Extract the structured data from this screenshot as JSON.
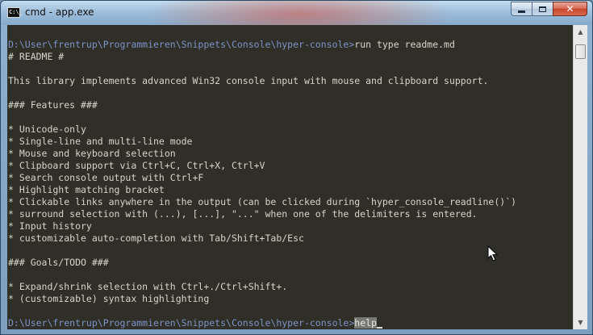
{
  "window": {
    "title": "cmd - app.exe",
    "icon_text": "C:\\_",
    "buttons": {
      "minimize": "minimize-icon",
      "maximize": "maximize-icon",
      "close": "✕"
    }
  },
  "console": {
    "command_prompt": "D:\\User\\frentrup\\Programmieren\\Snippets\\Console\\hyper-console>",
    "command": "run type readme.md",
    "output_lines": [
      "# README #",
      "",
      "This library implements advanced Win32 console input with mouse and clipboard support.",
      "",
      "### Features ###",
      "",
      "* Unicode-only",
      "* Single-line and multi-line mode",
      "* Mouse and keyboard selection",
      "* Clipboard support via Ctrl+C, Ctrl+X, Ctrl+V",
      "* Search console output with Ctrl+F",
      "* Highlight matching bracket",
      "* Clickable links anywhere in the output (can be clicked during `hyper_console_readline()`)",
      "* surround selection with (...), [...], \"...\" when one of the delimiters is entered.",
      "* Input history",
      "* customizable auto-completion with Tab/Shift+Tab/Esc",
      "",
      "### Goals/TODO ###",
      "",
      "* Expand/shrink selection with Ctrl+./Ctrl+Shift+.",
      "* (customizable) syntax highlighting",
      ""
    ],
    "input_prompt": "D:\\User\\frentrup\\Programmieren\\Snippets\\Console\\hyper-console>",
    "input_value": "help"
  },
  "scrollbar": {
    "up_icon": "▲",
    "down_icon": "▼"
  },
  "colors": {
    "console_bg": "#2f2f27",
    "console_text": "#d6d6c8",
    "prompt_text": "#7e93c8",
    "selection_bg": "#777a74"
  }
}
